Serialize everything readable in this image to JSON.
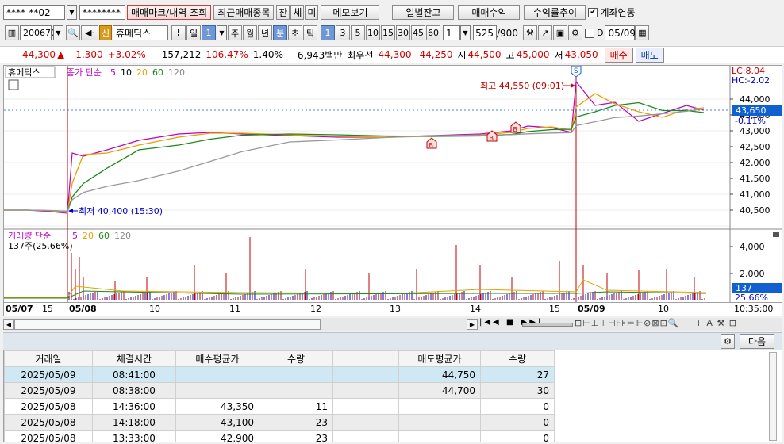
{
  "toolbar1": {
    "account": "****-**02",
    "password": "********",
    "trade_history_btn": "매매마크/내역 조회",
    "recent_stocks_btn": "최근매매종목",
    "btn_jan": "잔",
    "btn_che": "체",
    "btn_mi": "미",
    "memo_btn": "메모보기",
    "daily_balance_btn": "일별잔고",
    "trade_profit_btn": "매매수익",
    "return_trend_btn": "수익률추이",
    "account_link_label": "계좌연동"
  },
  "toolbar2": {
    "code": "200670",
    "credit_badge": "신",
    "stock_name": "휴메딕스",
    "period_day": "일",
    "period_day_num": "1",
    "period_week": "주",
    "period_month": "월",
    "period_year": "년",
    "period_min": "분",
    "period_sec": "초",
    "period_tick": "틱",
    "intervals": [
      "1",
      "3",
      "5",
      "10",
      "15",
      "30",
      "45",
      "60"
    ],
    "interval_input": "1",
    "count_value": "525",
    "count_total": "/900",
    "date_value": "05/09"
  },
  "quote": {
    "price": "44,300",
    "change": "1,300",
    "change_rate": "+3.02%",
    "volume": "157,212",
    "volume_ratio": "106.47%",
    "turnover": "1.40%",
    "amount": "6,943백만",
    "priority_label": "최우선",
    "ask": "44,300",
    "bid": "44,250",
    "open_label": "시",
    "open": "44,500",
    "high_label": "고",
    "high": "45,000",
    "low_label": "저",
    "low": "43,050",
    "buy_btn": "매수",
    "sell_btn": "매도"
  },
  "price_panel": {
    "stock_label": "휴메딕스",
    "ma_label": "종가 단순",
    "ma_periods": [
      "5",
      "10",
      "20",
      "60",
      "120"
    ],
    "ma_colors": [
      "#c000c0",
      "#000000",
      "#e8a000",
      "#1a8a1a",
      "#888888"
    ],
    "high_annot": "최고 44,550 (09:01)",
    "low_annot": "최저 40,400 (15:30)",
    "s_marker": "S",
    "b_marker": "B",
    "lc": "LC:8.04",
    "hc": "HC:-2.02",
    "current_price": "43,650",
    "current_rate": "-0.11%"
  },
  "volume_panel": {
    "label": "거래량 단순",
    "ma_periods": [
      "5",
      "20",
      "60",
      "120"
    ],
    "sub_label": "137주(25.66%)",
    "current_volume": "137",
    "current_rate": "25.66%"
  },
  "chart_data": {
    "type": "line",
    "title": "",
    "price_axis_ticks": [
      "44,000",
      "43,500",
      "43,000",
      "42,500",
      "42,000",
      "41,500",
      "41,000",
      "40,500"
    ],
    "volume_axis_ticks": [
      "4,000",
      "2,000"
    ],
    "x_tick_labels": [
      "05/07",
      "15",
      "05/08",
      "10",
      "11",
      "12",
      "13",
      "14",
      "15",
      "05/09",
      "10",
      "10:35:00"
    ],
    "series": [
      {
        "values": [
          40500,
          40500,
          40450,
          40400,
          42300,
          42200,
          42400,
          42700,
          42900,
          42950,
          42900,
          42850,
          42800,
          42800,
          42850,
          42900,
          43000,
          43150,
          43100,
          42950,
          44550,
          43800,
          43900,
          43300,
          43550,
          43800,
          43650
        ]
      }
    ],
    "annotations": [
      "최고 44,550 (09:01)",
      "최저 40,400 (15:30)"
    ]
  },
  "trade_table": {
    "headers": [
      "거래일",
      "체결시간",
      "매수평균가",
      "수량",
      "",
      "매도평균가",
      "수량"
    ],
    "rows": [
      [
        "2025/05/09",
        "08:41:00",
        "",
        "",
        "",
        "44,750",
        "27"
      ],
      [
        "2025/05/09",
        "08:38:00",
        "",
        "",
        "",
        "44,700",
        "30"
      ],
      [
        "2025/05/08",
        "14:36:00",
        "43,350",
        "11",
        "",
        "",
        "0"
      ],
      [
        "2025/05/08",
        "14:18:00",
        "43,100",
        "23",
        "",
        "",
        "0"
      ],
      [
        "2025/05/08",
        "13:33:00",
        "42,900",
        "23",
        "",
        "",
        "0"
      ]
    ],
    "next_btn": "다음"
  }
}
